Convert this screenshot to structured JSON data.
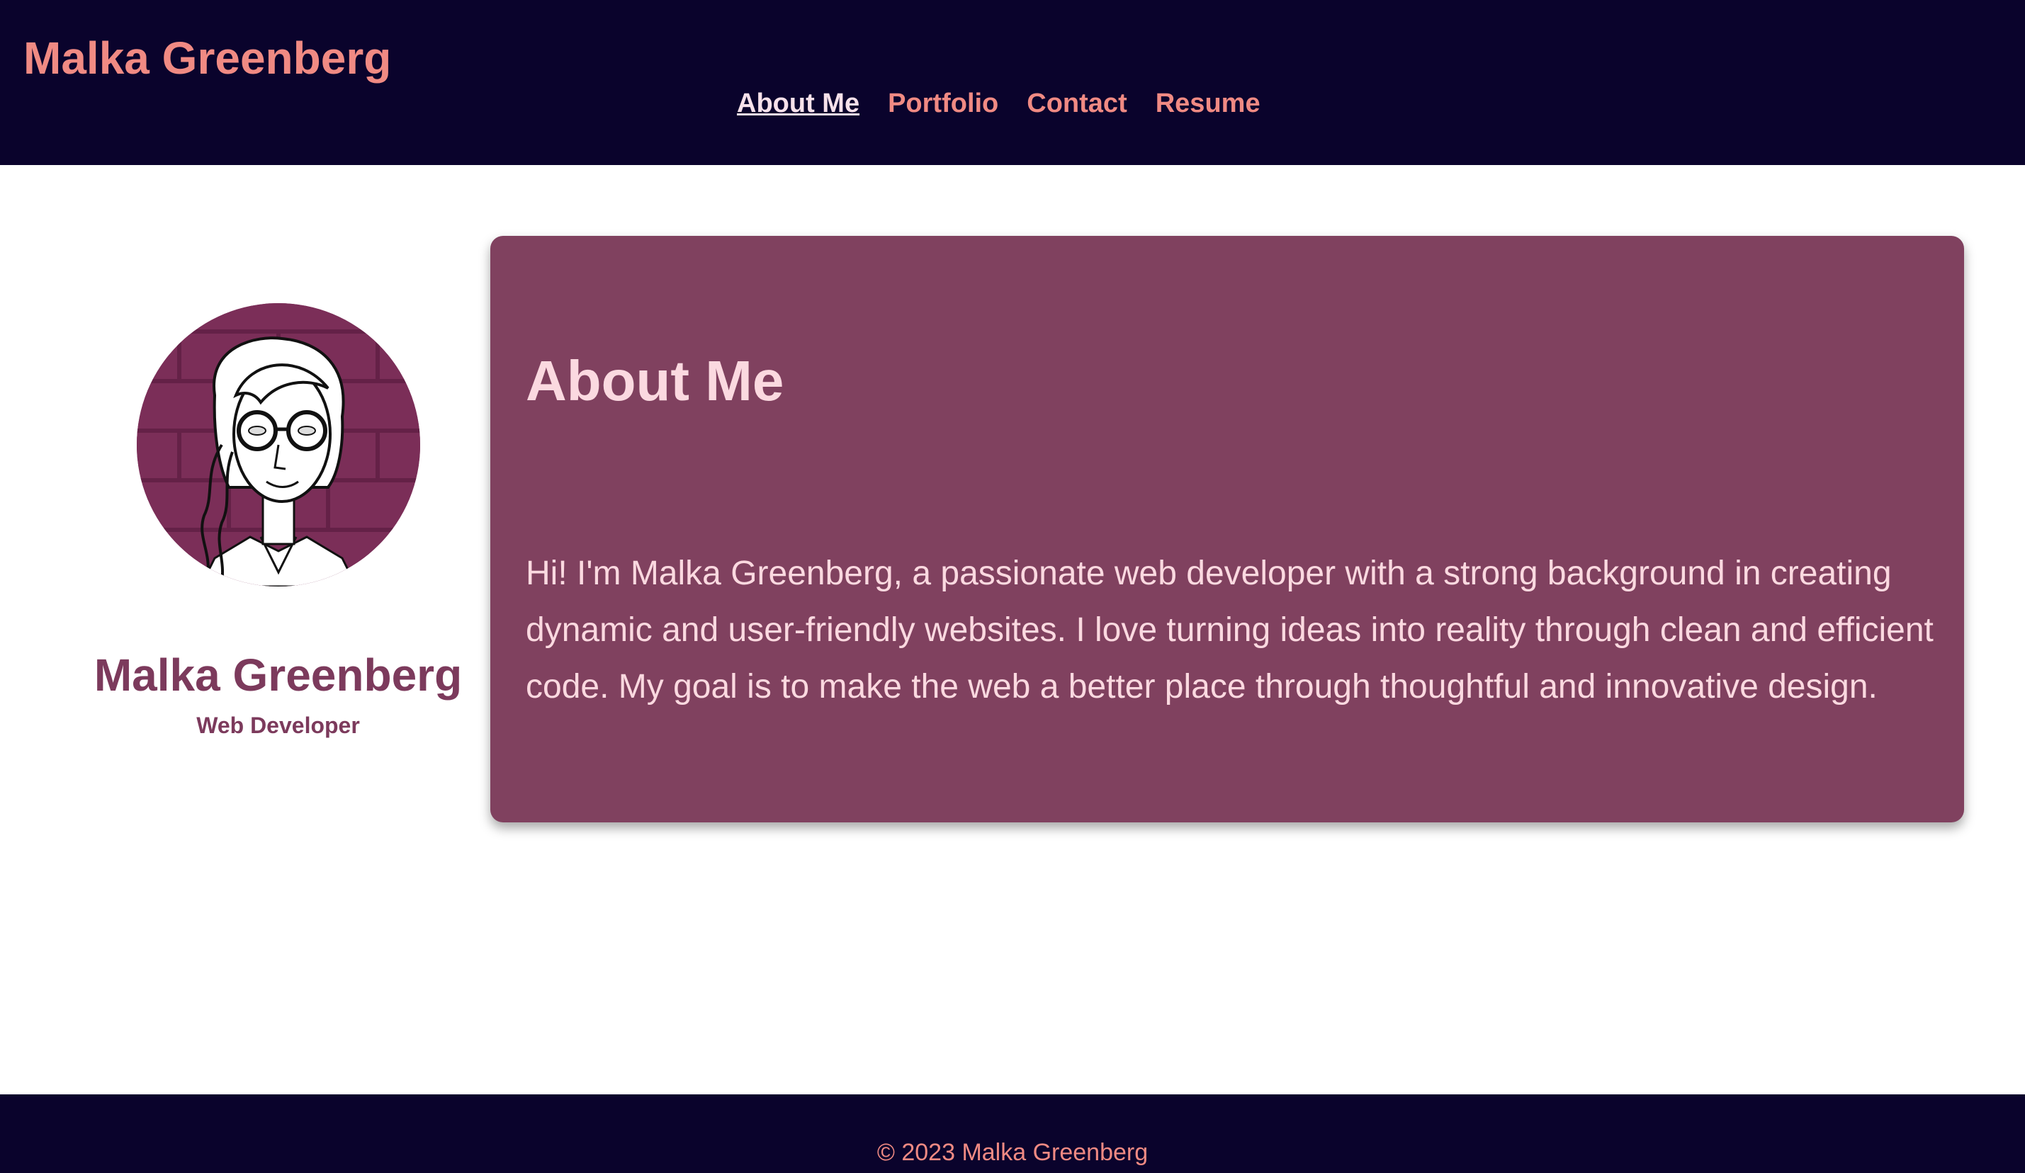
{
  "header": {
    "brand": "Malka Greenberg",
    "nav": [
      {
        "label": "About Me",
        "active": true
      },
      {
        "label": "Portfolio",
        "active": false
      },
      {
        "label": "Contact",
        "active": false
      },
      {
        "label": "Resume",
        "active": false
      }
    ]
  },
  "profile": {
    "name": "Malka Greenberg",
    "role": "Web Developer",
    "avatar_icon": "illustrated-portrait-avatar"
  },
  "about": {
    "heading": "About Me",
    "body": "Hi! I'm Malka Greenberg, a passionate web developer with a strong background in creating dynamic and user-friendly websites. I love turning ideas into reality through clean and efficient code. My goal is to make the web a better place through thoughtful and innovative design."
  },
  "footer": {
    "copyright": "© 2023 Malka Greenberg"
  },
  "colors": {
    "header_bg": "#0a032c",
    "accent": "#f08a83",
    "active_nav": "#f7e1ea",
    "card_bg": "#80415f",
    "card_text": "#fbd9e0",
    "profile_text": "#7c3a5c"
  }
}
